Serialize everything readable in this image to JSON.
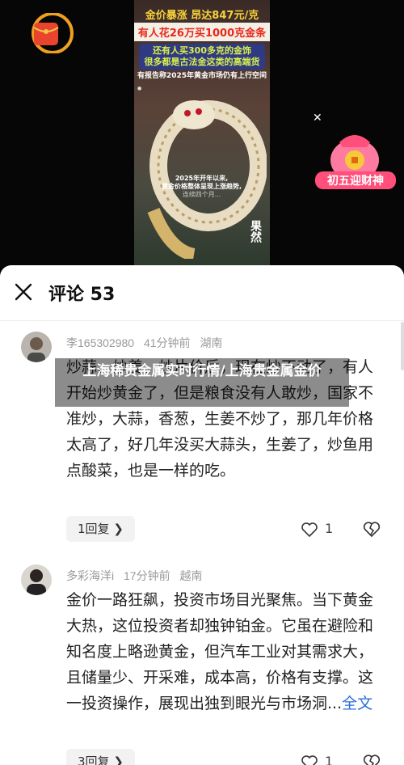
{
  "video": {
    "banner_line1": "金价暴涨 昂达847元/克",
    "banner_line2": "有人花26万买1000克金条",
    "banner_line3": "还有人买300多克的金饰",
    "banner_line4": "很多都是古法金这类的高端货",
    "banner_line5": "有报告称2025年黄金市场仍有上行空间",
    "overlay_line1": "2025年开年以来,",
    "overlay_line2": "黄金价格整体呈现上涨趋势,",
    "overlay_line3": "连续四个月...",
    "signature": "果然",
    "promo_label": "初五迎财神"
  },
  "sheet": {
    "title": "评论 53"
  },
  "comments": [
    {
      "user": "李165302980",
      "time": "41分钟前",
      "location": "湖南",
      "text": "炒蒜、炒姜、炒片价后，现在炒不动了，有人开始炒黄金了，但是粮食没有人敢炒，国家不准炒，大蒜，香葱，生姜不炒了，那几年价格太高了，好几年没买大蒜头，生姜了，炒鱼用点酸菜，也是一样的吃。",
      "reply_label": "1回复",
      "likes": "1"
    },
    {
      "user": "多彩海洋i",
      "time": "17分钟前",
      "location": "越南",
      "text": "金价一路狂飙，投资市场目光聚焦。当下黄金大热，这位投资者却独钟铂金。它虽在避险和知名度上略逊黄金，但汽车工业对其需求大，且储量少、开采难，成本高，价格有支撑。这一投资操作，展现出独到眼光与市场洞...",
      "full_label": "全文",
      "reply_label": "3回复",
      "likes": "1"
    }
  ],
  "article_title": "上海稀贵金属实时行情/上海贵金属金价"
}
